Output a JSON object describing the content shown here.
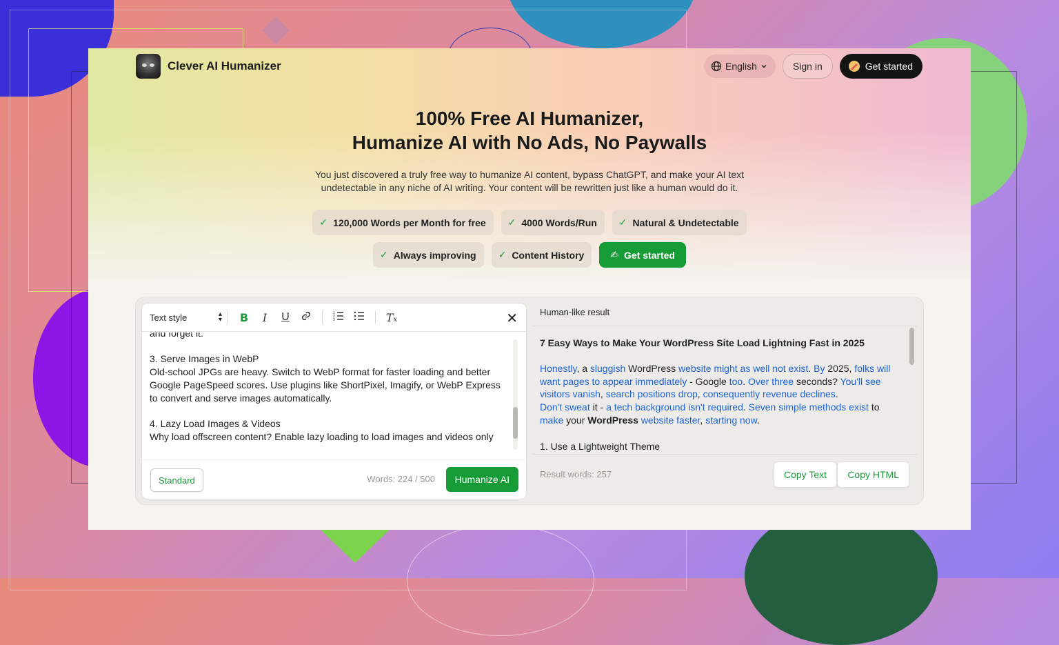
{
  "header": {
    "brand": "Clever AI Humanizer",
    "language": "English",
    "sign_in": "Sign in",
    "get_started": "Get started"
  },
  "hero": {
    "title_line1": "100% Free AI Humanizer,",
    "title_line2": "Humanize AI with No Ads, No Paywalls",
    "subtitle_line1": "You just discovered a truly free way to humanize AI content, bypass ChatGPT, and make your AI text",
    "subtitle_line2": "undetectable in any niche of AI writing. Your content will be rewritten just like a human would do it."
  },
  "features": {
    "row1": [
      "120,000 Words per Month for free",
      "4000 Words/Run",
      "Natural & Undetectable"
    ],
    "row2": [
      "Always improving",
      "Content History"
    ],
    "cta": "Get started"
  },
  "editor": {
    "text_style": "Text style",
    "lines": [
      "and forget it.",
      "",
      "3. Serve Images in WebP",
      "Old-school JPGs are heavy. Switch to WebP format for faster loading and better",
      "Google PageSpeed scores. Use plugins like ShortPixel, Imagify, or WebP Express",
      "to convert and serve images automatically.",
      "",
      "4. Lazy Load Images & Videos",
      "Why load offscreen content? Enable lazy loading to load images and videos only"
    ],
    "mode": "Standard",
    "word_count": "Words: 224 / 500",
    "humanize": "Humanize AI"
  },
  "result": {
    "heading": "Human-like result",
    "title": "7 Easy Ways to Make Your WordPress Site Load Lightning Fast in 2025",
    "p1": {
      "a": "Honestly",
      "b": ", a ",
      "c": "sluggish",
      "d": " WordPress ",
      "e": "website might as well not exist",
      "f": ". ",
      "g": "By",
      "h": " 2025, ",
      "i": "folks will want pages to appear immediately",
      "j": " - Google ",
      "k": "too",
      "l": ". ",
      "m": "Over three",
      "n": " seconds? ",
      "o": "You'll see visitors vanish",
      "p": ", ",
      "q": "search positions drop",
      "r": ", ",
      "s": "consequently revenue declines",
      "t": "."
    },
    "p2": {
      "a": "Don't sweat",
      "b": " it - ",
      "c": "a tech background isn't required",
      "d": ". ",
      "e": "Seven simple methods exist",
      "f": " to ",
      "g": "make",
      "h": " your ",
      "i": "WordPress",
      "j": " ",
      "k": "website faster",
      "l": ", ",
      "m": "starting now",
      "n": "."
    },
    "next_line": "1. Use a Lightweight Theme",
    "result_words": "Result words: 257",
    "copy_text": "Copy Text",
    "copy_html": "Copy HTML"
  }
}
